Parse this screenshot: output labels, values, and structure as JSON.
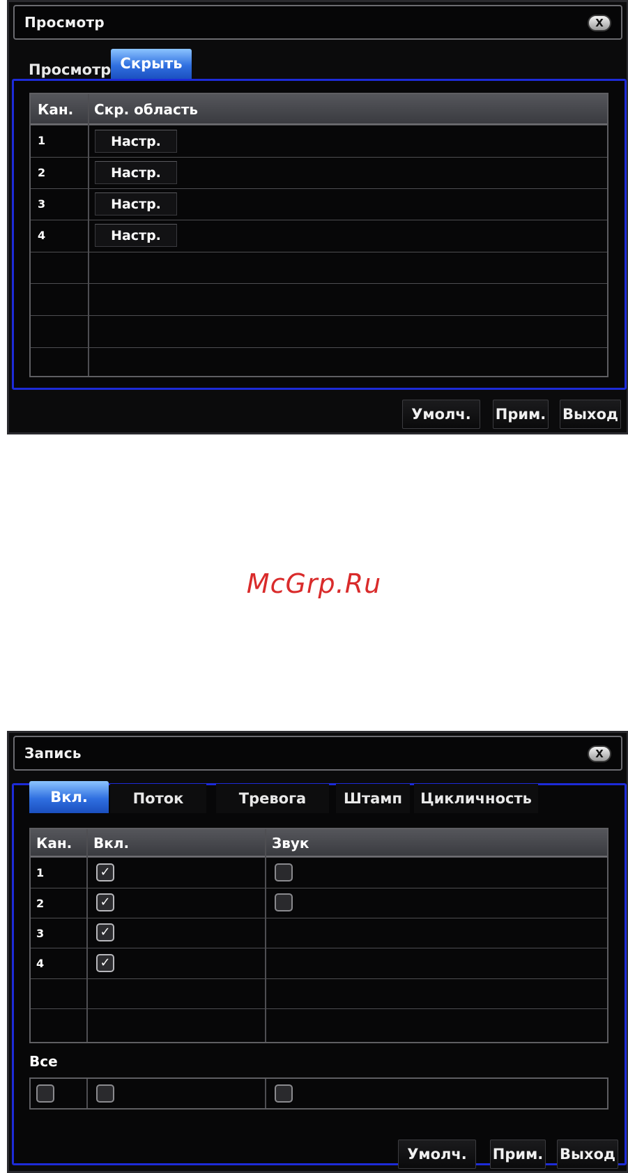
{
  "screen1": {
    "title": "Просмотр",
    "close_label": "X",
    "tabs": [
      {
        "label": "Просмотр",
        "active": false
      },
      {
        "label": "Скрыть",
        "active": true
      }
    ],
    "columns": [
      "Кан.",
      "Скр. область"
    ],
    "rows": [
      {
        "channel": "1",
        "button": "Настр."
      },
      {
        "channel": "2",
        "button": "Настр."
      },
      {
        "channel": "3",
        "button": "Настр."
      },
      {
        "channel": "4",
        "button": "Настр."
      }
    ],
    "footer": {
      "default": "Умолч.",
      "apply": "Прим.",
      "exit": "Выход"
    }
  },
  "watermark": "McGrp.Ru",
  "screen2": {
    "title": "Запись",
    "close_label": "X",
    "tabs": [
      {
        "label": "Вкл.",
        "active": true
      },
      {
        "label": "Поток",
        "active": false
      },
      {
        "label": "Тревога",
        "active": false
      },
      {
        "label": "Штамп",
        "active": false
      },
      {
        "label": "Цикличность",
        "active": false
      }
    ],
    "columns": [
      "Кан.",
      "Вкл.",
      "Звук"
    ],
    "rows": [
      {
        "channel": "1",
        "enabled": true,
        "audio": false,
        "has_audio": true
      },
      {
        "channel": "2",
        "enabled": true,
        "audio": false,
        "has_audio": true
      },
      {
        "channel": "3",
        "enabled": true,
        "has_audio": false
      },
      {
        "channel": "4",
        "enabled": true,
        "has_audio": false
      }
    ],
    "all_label": "Все",
    "check_glyph": "✓",
    "footer": {
      "default": "Умолч.",
      "apply": "Прим.",
      "exit": "Выход"
    }
  },
  "colors": {
    "panel_border": "#1d2bd8",
    "tab_active": "#2f6fe0",
    "watermark": "#d92b2b"
  }
}
